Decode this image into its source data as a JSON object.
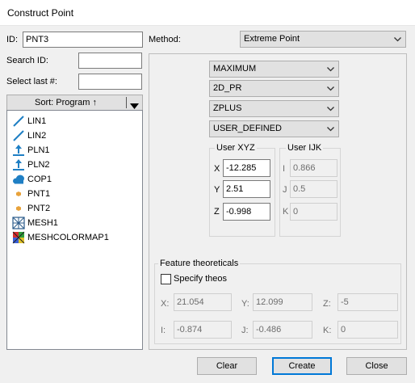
{
  "window": {
    "title": "Construct Point"
  },
  "id_field": {
    "label": "ID:",
    "value": "PNT3"
  },
  "search_id": {
    "label": "Search ID:",
    "value": ""
  },
  "select_last": {
    "label": "Select last #:",
    "value": ""
  },
  "sort_button": {
    "label": "Sort: Program ↑"
  },
  "feature_list": [
    {
      "label": "LIN1",
      "icon": "line-icon"
    },
    {
      "label": "LIN2",
      "icon": "line-icon"
    },
    {
      "label": "PLN1",
      "icon": "plane-icon"
    },
    {
      "label": "PLN2",
      "icon": "plane-icon"
    },
    {
      "label": "COP1",
      "icon": "point-cloud-icon"
    },
    {
      "label": "PNT1",
      "icon": "point-icon"
    },
    {
      "label": "PNT2",
      "icon": "point-icon"
    },
    {
      "label": "MESH1",
      "icon": "mesh-icon"
    },
    {
      "label": "MESHCOLORMAP1",
      "icon": "mesh-colormap-icon"
    }
  ],
  "method": {
    "label": "Method:",
    "value": "Extreme Point"
  },
  "options": {
    "extreme": "MAXIMUM",
    "projection": "2D_PR",
    "direction": "ZPLUS",
    "mode": "USER_DEFINED"
  },
  "user_xyz": {
    "title": "User XYZ",
    "x_label": "X",
    "x": "-12.285",
    "y_label": "Y",
    "y": "2.51",
    "z_label": "Z",
    "z": "-0.998"
  },
  "user_ijk": {
    "title": "User IJK",
    "i_label": "I",
    "i": "0.866",
    "j_label": "J",
    "j": "0.5",
    "k_label": "K",
    "k": "0"
  },
  "theoreticals": {
    "title": "Feature theoreticals",
    "specify_label": "Specify theos",
    "x_label": "X:",
    "x": "21.054",
    "y_label": "Y:",
    "y": "12.099",
    "z_label": "Z:",
    "z": "-5",
    "i_label": "I:",
    "i": "-0.874",
    "j_label": "J:",
    "j": "-0.486",
    "k_label": "K:",
    "k": "0"
  },
  "buttons": {
    "clear": "Clear",
    "create": "Create",
    "close": "Close"
  },
  "colors": {
    "accent": "#0078d7",
    "line_icon": "#1f7fc4",
    "point_icon": "#e8a23b"
  }
}
